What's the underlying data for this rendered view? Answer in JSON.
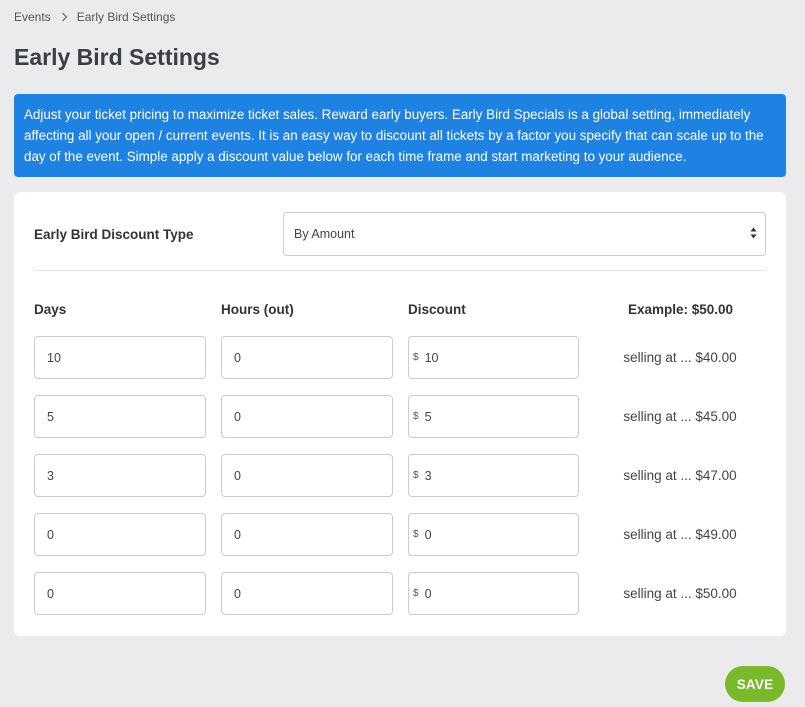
{
  "breadcrumb": {
    "items": [
      "Events",
      "Early Bird Settings"
    ]
  },
  "page": {
    "title": "Early Bird Settings"
  },
  "info": {
    "text": "Adjust your ticket pricing to maximize ticket sales. Reward early buyers. Early Bird Specials is a global setting, immediately affecting all your open / current events. It is an easy way to discount all tickets by a factor you specify that can scale up to the day of the event. Simple apply a discount value below for each time frame and start marketing to your audience."
  },
  "discount_type": {
    "label": "Early Bird Discount Type",
    "selected": "By Amount"
  },
  "columns": {
    "days": "Days",
    "hours": "Hours (out)",
    "discount": "Discount",
    "example": "Example: $50.00"
  },
  "currency_symbol": "$",
  "rows": [
    {
      "days": "10",
      "hours": "0",
      "discount": "10",
      "selling": "selling at ... $40.00"
    },
    {
      "days": "5",
      "hours": "0",
      "discount": "5",
      "selling": "selling at ... $45.00"
    },
    {
      "days": "3",
      "hours": "0",
      "discount": "3",
      "selling": "selling at ... $47.00"
    },
    {
      "days": "0",
      "hours": "0",
      "discount": "0",
      "selling": "selling at ... $49.00"
    },
    {
      "days": "0",
      "hours": "0",
      "discount": "0",
      "selling": "selling at ... $50.00"
    }
  ],
  "actions": {
    "save_label": "SAVE"
  },
  "colors": {
    "banner": "#1d82e1",
    "save": "#7ab929",
    "background": "#ebebed"
  }
}
